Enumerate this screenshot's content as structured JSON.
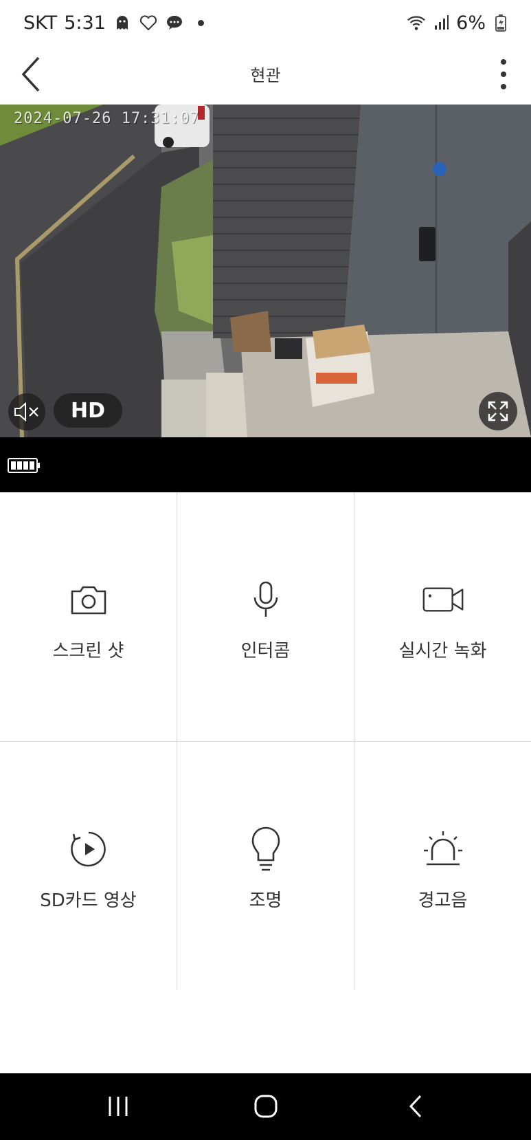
{
  "status_bar": {
    "carrier": "SKT",
    "time": "5:31",
    "battery": "6%"
  },
  "header": {
    "title": "현관"
  },
  "camera": {
    "timestamp": "2024-07-26 17:31:07",
    "quality": "HD"
  },
  "controls": [
    {
      "label": "스크린 샷",
      "icon": "camera-icon"
    },
    {
      "label": "인터콤",
      "icon": "microphone-icon"
    },
    {
      "label": "실시간 녹화",
      "icon": "video-camera-icon"
    },
    {
      "label": "SD카드 영상",
      "icon": "replay-icon"
    },
    {
      "label": "조명",
      "icon": "lightbulb-icon"
    },
    {
      "label": "경고음",
      "icon": "siren-icon"
    }
  ],
  "colors": {
    "strip": "#000000",
    "divider": "#d8d8d8"
  }
}
